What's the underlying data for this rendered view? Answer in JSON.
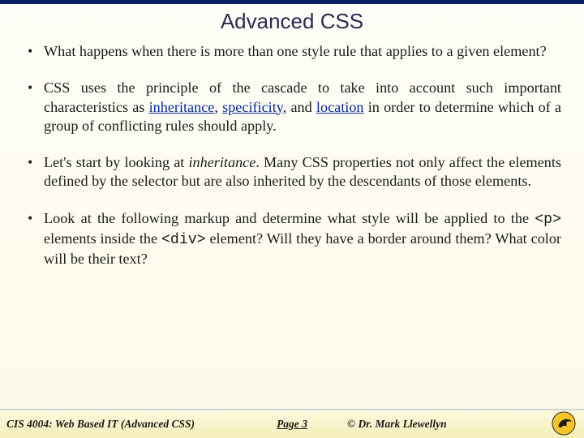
{
  "title": "Advanced CSS",
  "bullets": {
    "b1": "What happens when there is more than one style rule that applies to a given element?",
    "b2_pre": "CSS uses the principle of the cascade to take into account such important characteristics as ",
    "b2_term1": "inheritance",
    "b2_sep1": ", ",
    "b2_term2": "specificity",
    "b2_sep2": ", and ",
    "b2_term3": "location",
    "b2_post": " in order to determine which of a group of conflicting rules should apply.",
    "b3_pre": "Let's start by looking at ",
    "b3_ital": "inheritance",
    "b3_post": ".  Many CSS properties not only affect the elements defined by the selector but are also inherited by the descendants of those elements.",
    "b4_pre": "Look at the following markup and determine what style will be applied to the ",
    "b4_code1": "<p>",
    "b4_mid1": " elements inside the ",
    "b4_code2": "<div>",
    "b4_post": "  element?  Will they have a border around them?  What color will be their text?"
  },
  "footer": {
    "course": "CIS 4004: Web Based IT (Advanced CSS)",
    "page_label": "Page ",
    "page_number": "3",
    "copyright": "© Dr. Mark Llewellyn"
  }
}
